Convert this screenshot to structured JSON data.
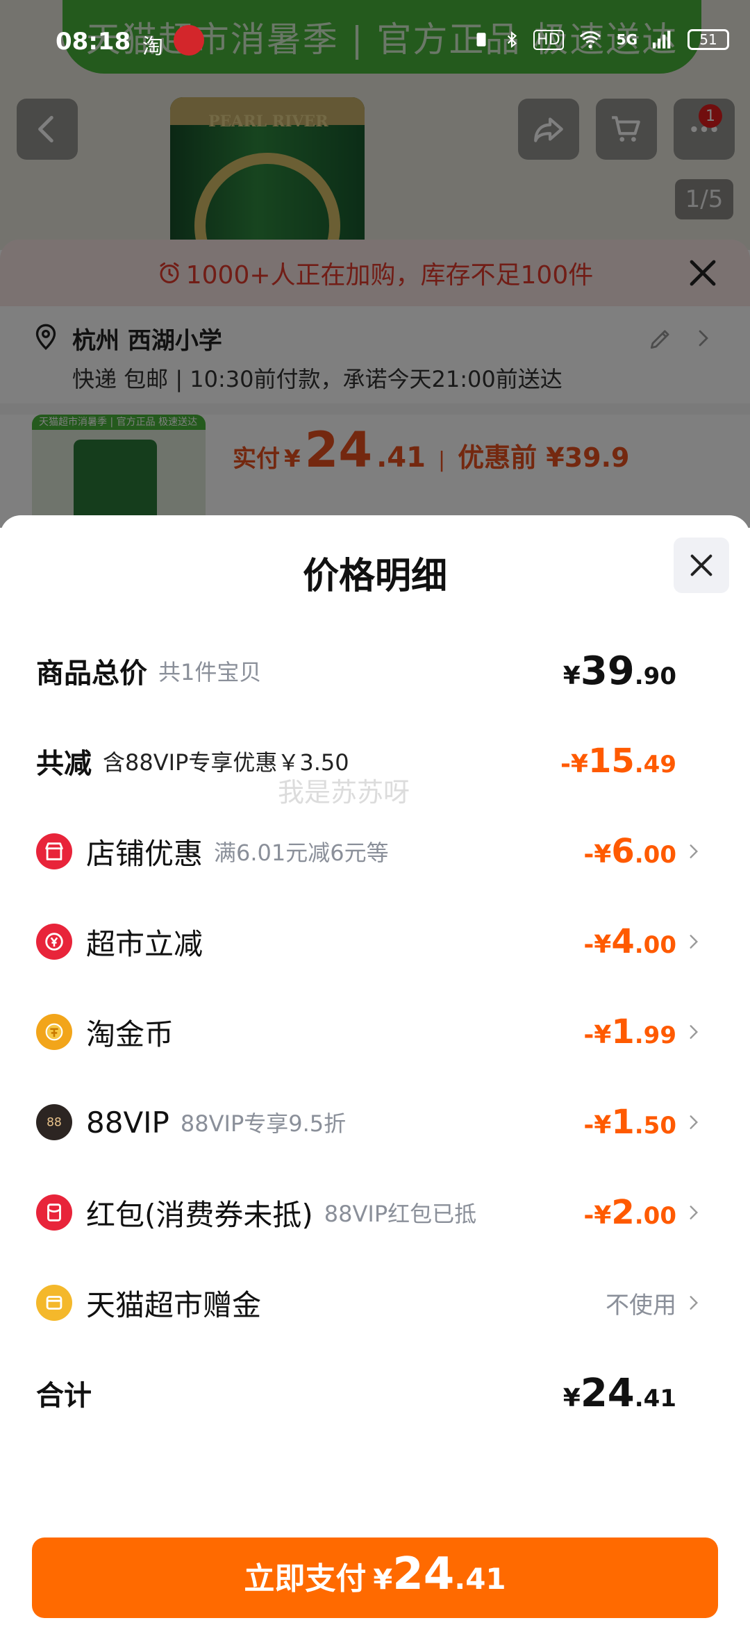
{
  "status_bar": {
    "time": "08:18",
    "taobao": "淘",
    "network": "5G",
    "hd": "HD",
    "battery": "51"
  },
  "banner": "天猫超市消暑季 | 官方正品 极速送达",
  "product_image": {
    "brand": "PEARL RIVER",
    "pager": "1/5",
    "cart_badge": "1"
  },
  "order_sheet": {
    "stock_alert": "1000+人正在加购，库存不足100件",
    "address_city": "杭州 西湖小学",
    "delivery_line": "快递 包邮 | 10:30前付款，承诺今天21:00前送达",
    "thumb_banner": "天猫超市消暑季 | 官方正品 极速送达",
    "pay_label": "实付",
    "pay_currency": "¥",
    "pay_int": "24",
    "pay_dec": ".41",
    "before_label": "优惠前 ¥39.9"
  },
  "detail": {
    "title": "价格明细",
    "total": {
      "label": "商品总价",
      "sub": "共1件宝贝",
      "cur": "¥",
      "int": "39",
      "dec": ".90"
    },
    "reduce": {
      "label": "共减",
      "sub": "含88VIP专享优惠￥3.50",
      "cur": "-¥",
      "int": "15",
      "dec": ".49"
    },
    "items": [
      {
        "name": "店铺优惠",
        "sub": "满6.01元减6元等",
        "cur": "-¥",
        "int": "6",
        "dec": ".00",
        "icon": "shop-icon",
        "color": "#e8243a"
      },
      {
        "name": "超市立减",
        "sub": "",
        "cur": "-¥",
        "int": "4",
        "dec": ".00",
        "icon": "yen-discount-icon",
        "color": "#e8243a"
      },
      {
        "name": "淘金币",
        "sub": "",
        "cur": "-¥",
        "int": "1",
        "dec": ".99",
        "icon": "coin-icon",
        "color": "#f2a51a"
      },
      {
        "name": "88VIP",
        "sub": "88VIP专享9.5折",
        "cur": "-¥",
        "int": "1",
        "dec": ".50",
        "icon": "vip-88-icon",
        "color": "#2c2522"
      },
      {
        "name": "红包(消费券未抵)",
        "sub": "88VIP红包已抵",
        "cur": "-¥",
        "int": "2",
        "dec": ".00",
        "icon": "red-packet-icon",
        "color": "#e8243a"
      }
    ],
    "gift": {
      "name": "天猫超市赠金",
      "value": "不使用",
      "icon": "gift-card-icon",
      "color": "#f4b82b"
    },
    "sum": {
      "label": "合计",
      "cur": "¥",
      "int": "24",
      "dec": ".41"
    },
    "watermark": "我是苏苏呀",
    "pay_button": {
      "label": "立即支付",
      "cur": "¥",
      "int": "24",
      "dec": ".41"
    }
  },
  "colors": {
    "accent": "#ff6a00",
    "discount": "#ff5a00"
  }
}
